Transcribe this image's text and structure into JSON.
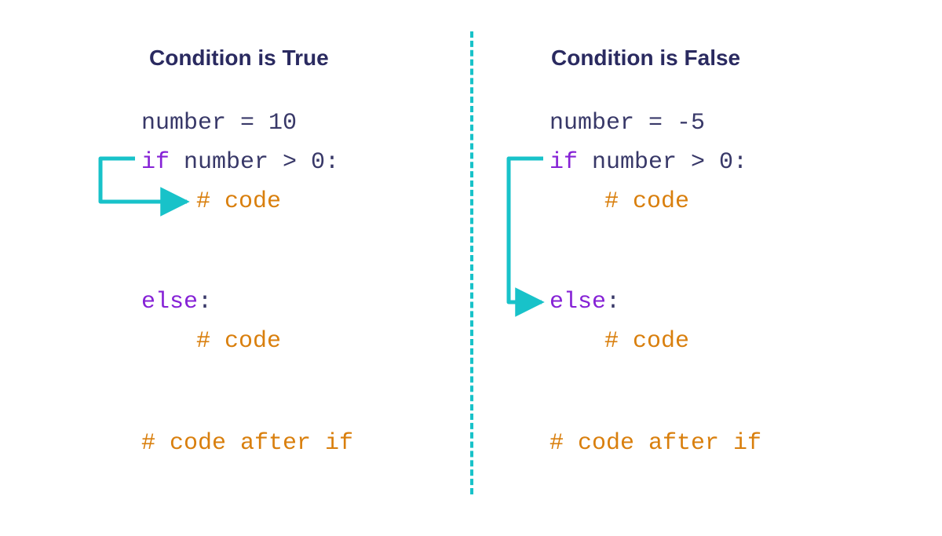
{
  "left": {
    "title": "Condition is True",
    "line1_a": "number = 10",
    "line2_kw": "if",
    "line2_rest": " number > 0:",
    "line3_cmt": "# code",
    "line4_kw": "else",
    "line4_colon": ":",
    "line5_cmt": "# code",
    "line6_cmt": "# code after if"
  },
  "right": {
    "title": "Condition is False",
    "line1_a": "number = -5",
    "line2_kw": "if",
    "line2_rest": " number > 0:",
    "line3_cmt": "# code",
    "line4_kw": "else",
    "line4_colon": ":",
    "line5_cmt": "# code",
    "line6_cmt": "# code after if"
  },
  "colors": {
    "arrow": "#18c2c9"
  }
}
